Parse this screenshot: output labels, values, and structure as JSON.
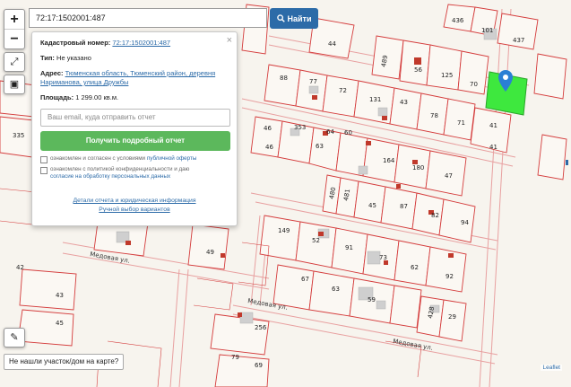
{
  "search": {
    "value": "72:17:1502001:487",
    "button_label": "Найти"
  },
  "map_controls": {
    "zoom_in": "+",
    "zoom_out": "−"
  },
  "popup": {
    "cadastral_label": "Кадастровый номер:",
    "cadastral_value": "72:17:1502001:487",
    "type_label": "Тип:",
    "type_value": "Не указано",
    "address_label": "Адрес:",
    "address_value": "Тюменская область, Тюменский район, деревня Наримановa, улица Дружбы",
    "area_label": "Площадь:",
    "area_value": "1 299.00 кв.м.",
    "email_placeholder": "Ваш email, куда отправить отчет",
    "report_button": "Получить подробный отчет",
    "consent1_text": "ознакомлен и согласен с условиями",
    "consent1_link": "публичной оферты",
    "consent2_text": "ознакомлен с политикой конфиденциальности и даю",
    "consent2_link": "согласие на обработку персональных данных",
    "details_link": "Детали отчета и юридическая информация",
    "manual_link": "Ручной выбор вариантов"
  },
  "bottom_tip": "Не нашли участок/дом на карте?",
  "attribution": "Leaflet",
  "streets": [
    "Медовая ул.",
    "Медовая ул.",
    "Медовая ул."
  ],
  "plots": [
    "436",
    "101",
    "437",
    "44",
    "489",
    "56",
    "125",
    "70",
    "88",
    "77",
    "72",
    "131",
    "43",
    "78",
    "71",
    "41",
    "46",
    "353",
    "64",
    "60",
    "46",
    "41",
    "335",
    "63",
    "164",
    "180",
    "47",
    "480",
    "481",
    "45",
    "87",
    "82",
    "94",
    "149",
    "52",
    "91",
    "73",
    "62",
    "92",
    "49",
    "42",
    "67",
    "63",
    "59",
    "43",
    "45",
    "256",
    "428",
    "29",
    "79",
    "69"
  ],
  "colors": {
    "accent": "#2c6ba8",
    "green_button": "#5cb85c",
    "plot_lines": "#d43b3b",
    "selected_plot": "#3ee83e",
    "marker": "#2a7fd4"
  }
}
